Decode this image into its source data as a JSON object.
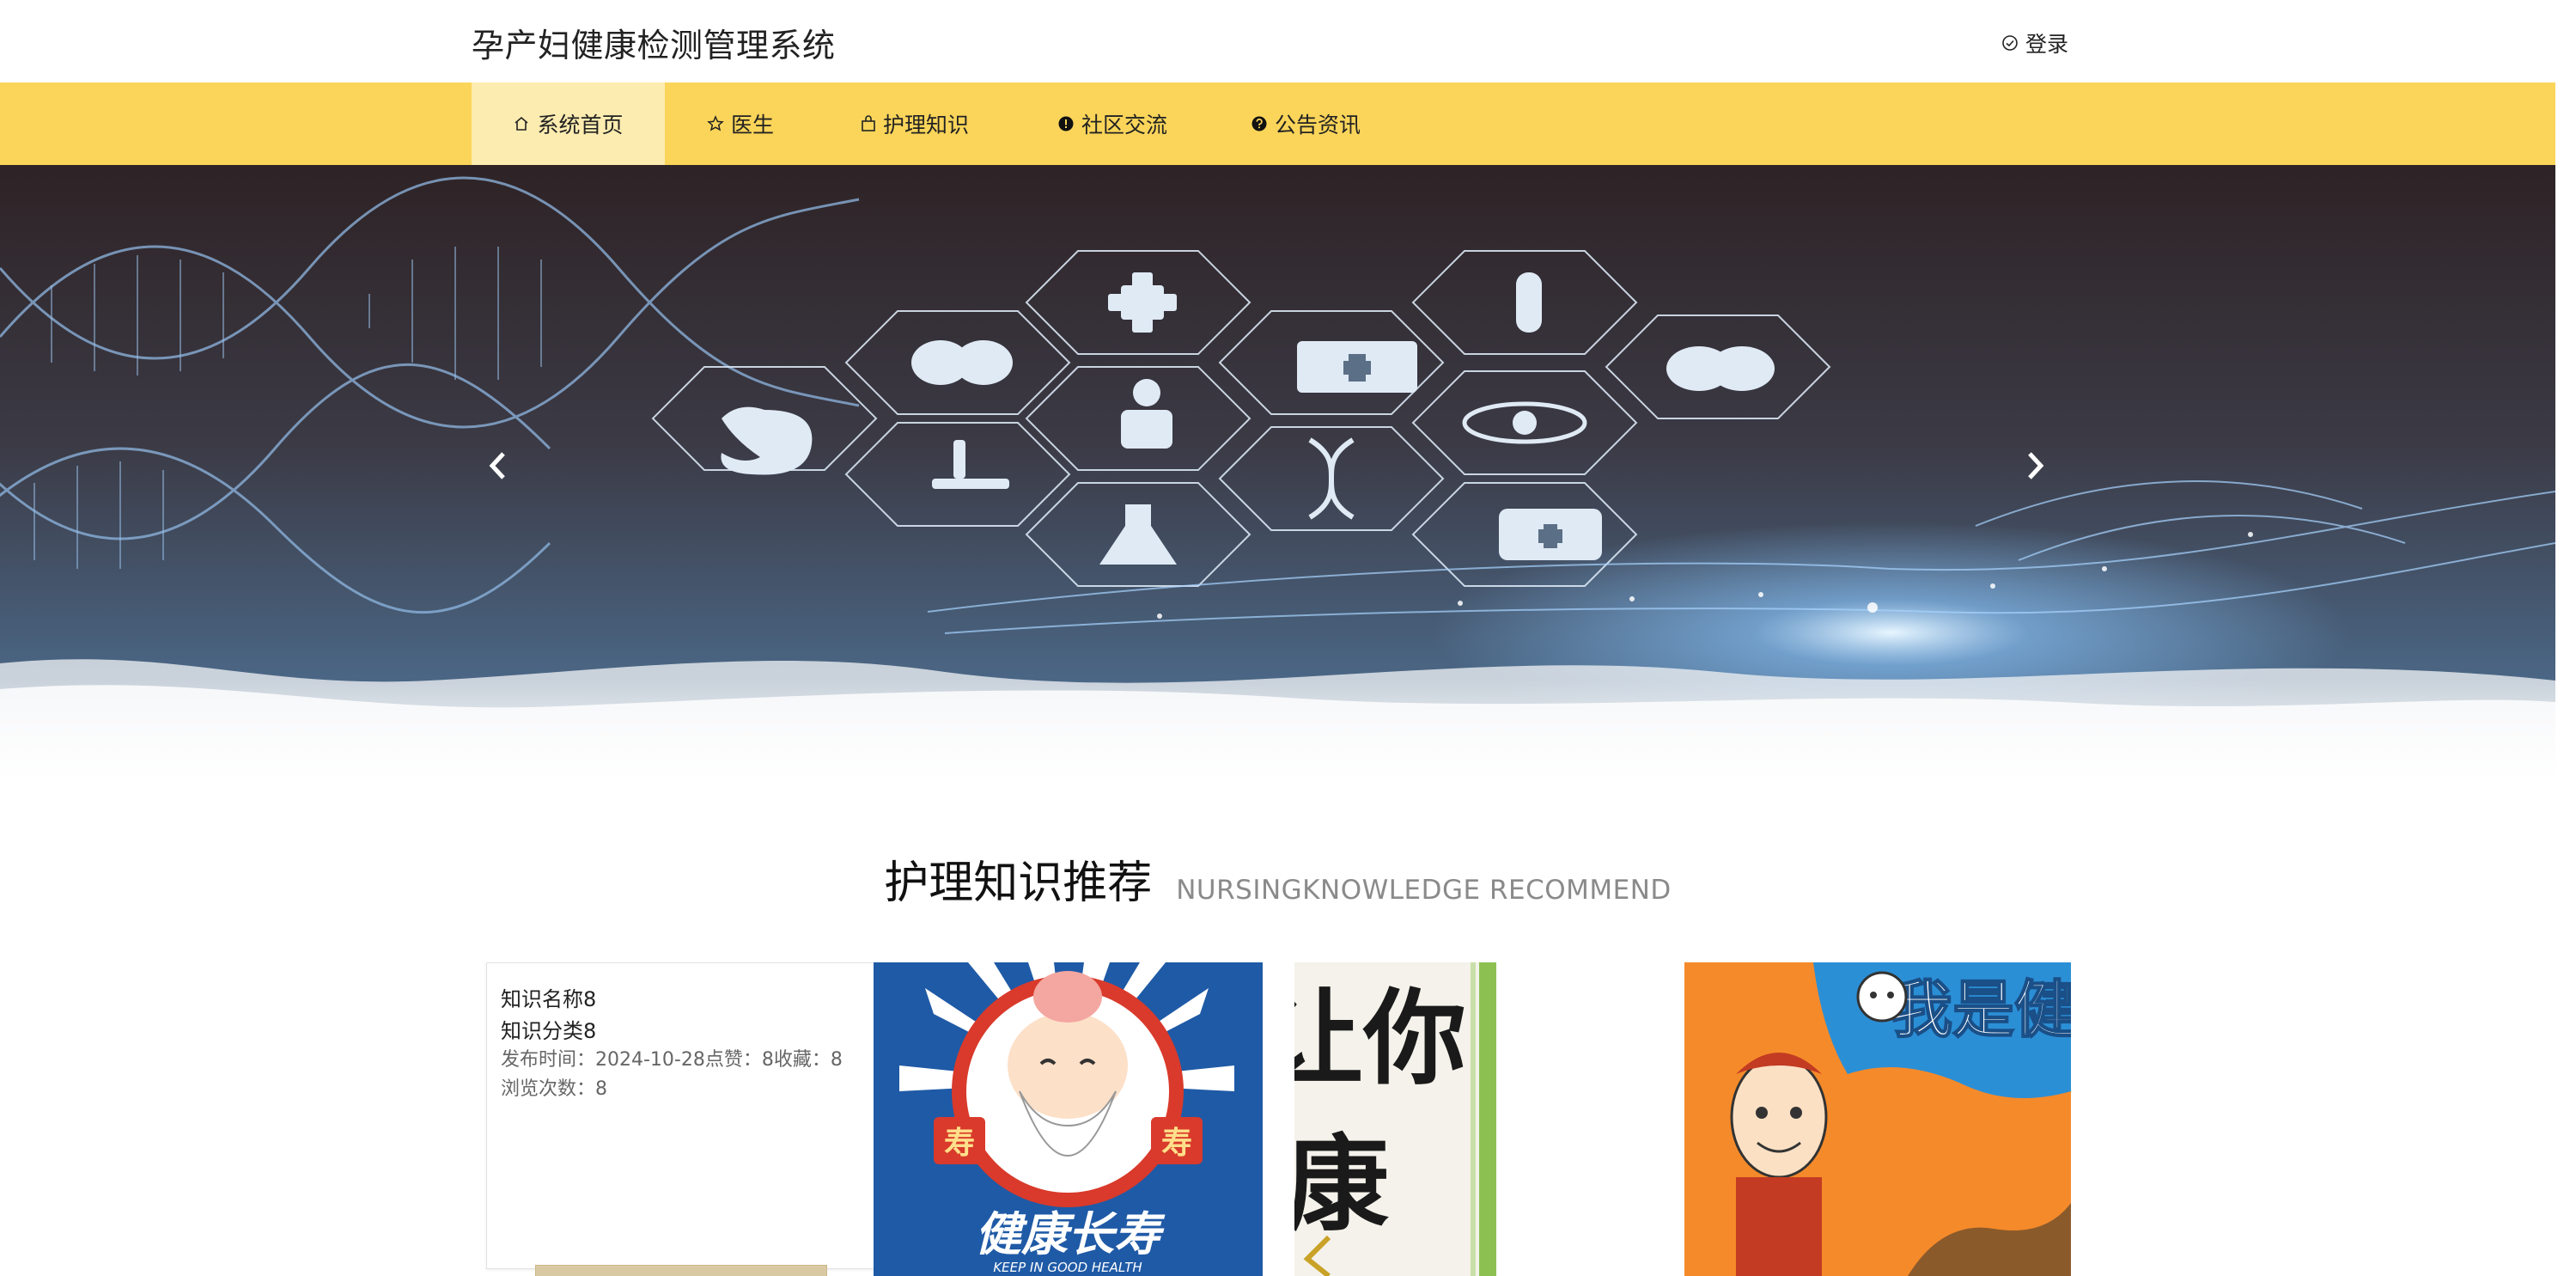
{
  "header": {
    "site_title": "孕产妇健康检测管理系统",
    "login_label": "登录"
  },
  "nav": {
    "items": [
      {
        "label": "系统首页",
        "icon": "home-icon",
        "active": true
      },
      {
        "label": "医生",
        "icon": "star-icon"
      },
      {
        "label": "护理知识",
        "icon": "bag-icon"
      },
      {
        "label": "社区交流",
        "icon": "info-icon"
      },
      {
        "label": "公告资讯",
        "icon": "question-icon"
      }
    ]
  },
  "section": {
    "title": "护理知识推荐",
    "subtitle": "NURSINGKNOWLEDGE RECOMMEND"
  },
  "knowledge_card": {
    "name": "知识名称8",
    "category": "知识分类8",
    "meta_line1": "发布时间：2024-10-28点赞：8收藏：8",
    "meta_line2": "浏览次数：8"
  },
  "card_images": {
    "poster1_text": "健康长寿",
    "poster1_sub": "KEEP IN GOOD HEALTH",
    "poster1_badge": "寿",
    "poster2_text_top": "让你",
    "poster2_text_bottom": "康",
    "poster3_text": "我是健康宝"
  },
  "colors": {
    "nav_bg": "#fbd55a",
    "nav_active": "#fdecb0",
    "banner_dark": "#2d2226"
  }
}
